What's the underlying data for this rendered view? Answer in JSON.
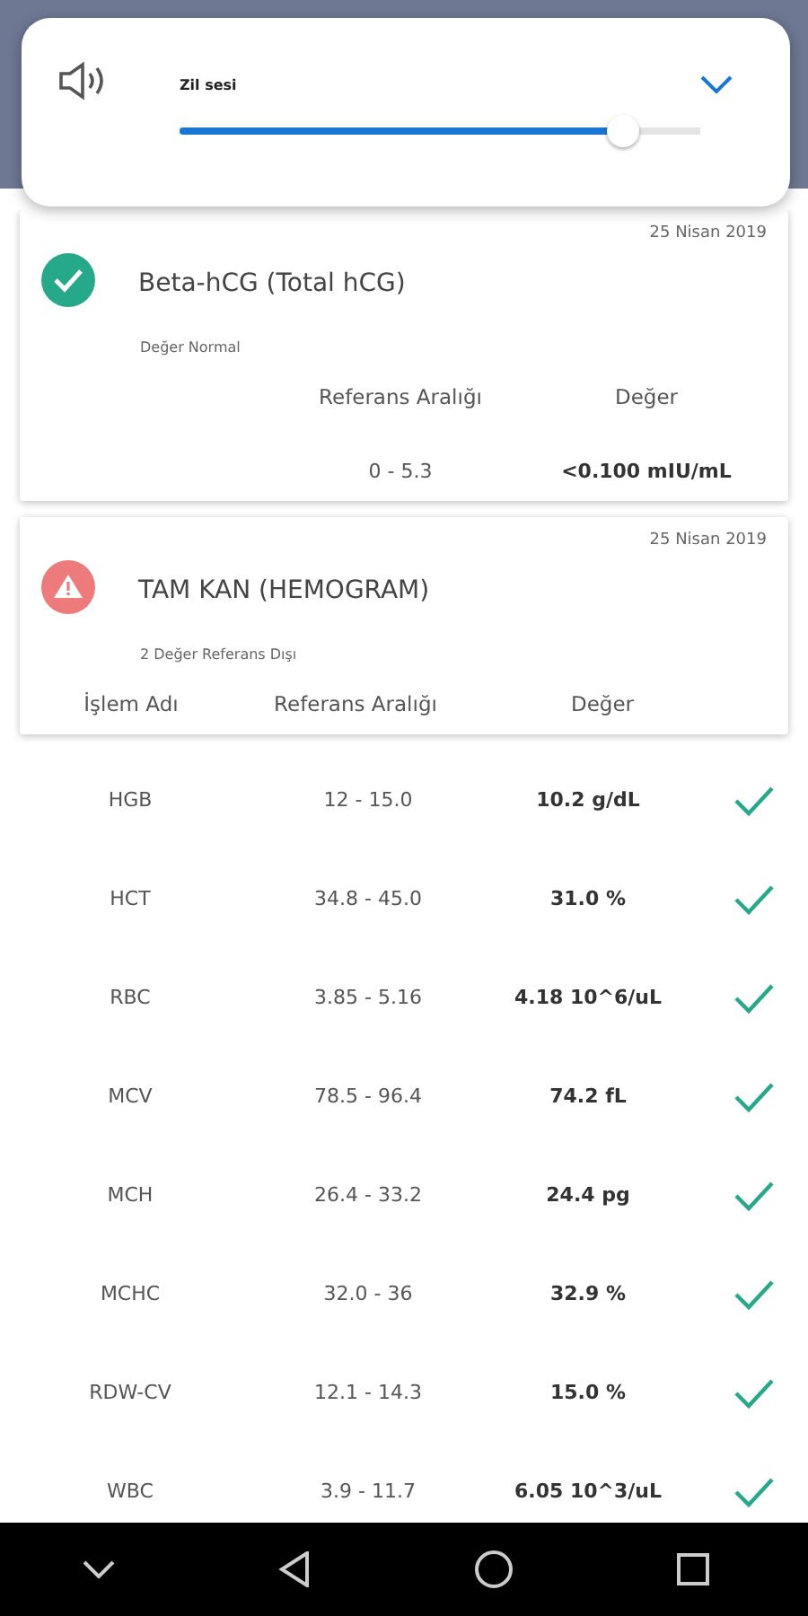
{
  "volume_panel": {
    "label": "Zil sesi",
    "level": 0.85
  },
  "results": [
    {
      "kind": "normal",
      "date": "25 Nisan 2019",
      "title": "Beta-hCG (Total hCG)",
      "summary": "Değer Normal",
      "columns": [
        "Referans Aralığı",
        "Değer"
      ],
      "rows": [
        {
          "range": "0 - 5.3",
          "value": "<0.100 mIU/mL"
        }
      ]
    },
    {
      "kind": "warning",
      "date": "25 Nisan 2019",
      "title": "TAM KAN (HEMOGRAM)",
      "summary": "2 Değer Referans Dışı",
      "columns": [
        "İşlem Adı",
        "Referans Aralığı",
        "Değer"
      ],
      "rows": [
        {
          "name": "HGB",
          "range": "12 - 15.0",
          "value": "10.2 g/dL"
        },
        {
          "name": "HCT",
          "range": "34.8 - 45.0",
          "value": "31.0 %"
        },
        {
          "name": "RBC",
          "range": "3.85 - 5.16",
          "value": "4.18 10^6/uL"
        },
        {
          "name": "MCV",
          "range": "78.5 - 96.4",
          "value": "74.2 fL"
        },
        {
          "name": "MCH",
          "range": "26.4 - 33.2",
          "value": "24.4 pg"
        },
        {
          "name": "MCHC",
          "range": "32.0 - 36",
          "value": "32.9 %"
        },
        {
          "name": "RDW-CV",
          "range": "12.1 - 14.3",
          "value": "15.0 %"
        },
        {
          "name": "WBC",
          "range": "3.9 - 11.7",
          "value": "6.05 10^3/uL"
        }
      ]
    }
  ]
}
